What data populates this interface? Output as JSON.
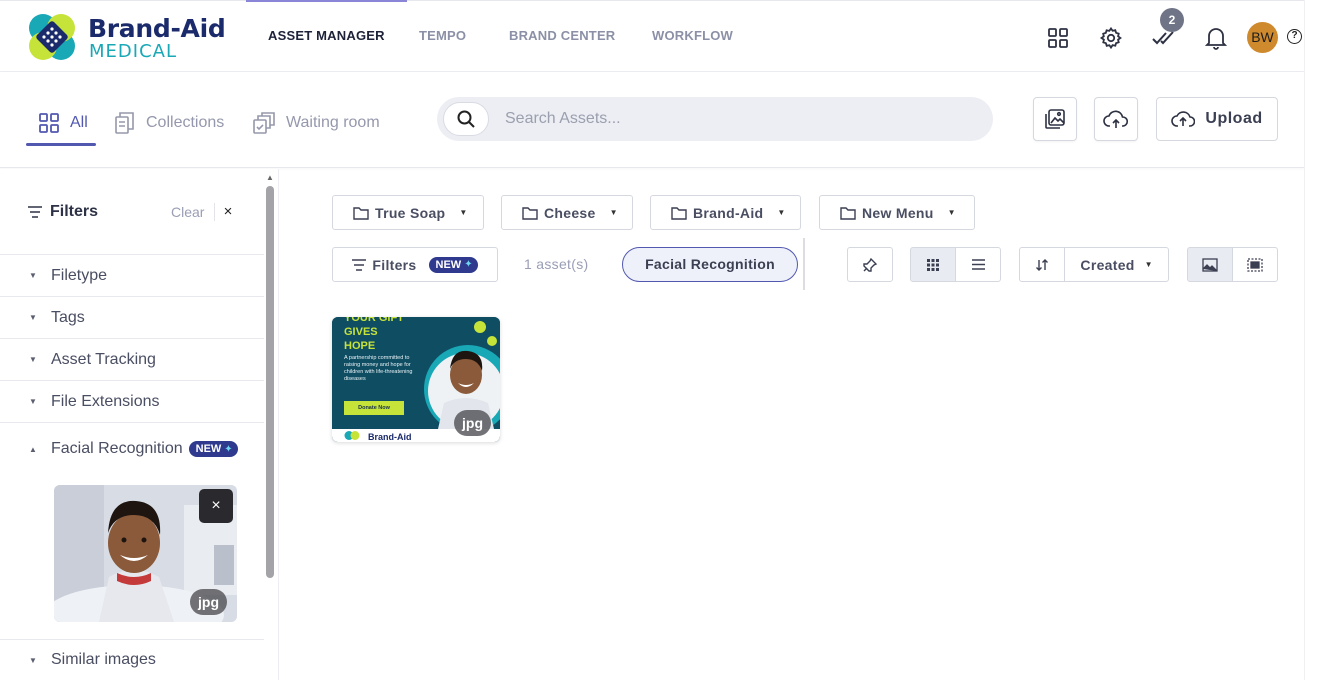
{
  "logo": {
    "line1": "Brand-Aid",
    "line2": "MEDICAL",
    "colors": {
      "navy": "#1b2a6b",
      "teal": "#19a8b6",
      "lime": "#c6e33a"
    }
  },
  "nav": {
    "tabs": [
      {
        "label": "ASSET MANAGER",
        "active": true
      },
      {
        "label": "TEMPO",
        "active": false
      },
      {
        "label": "BRAND CENTER",
        "active": false
      },
      {
        "label": "WORKFLOW",
        "active": false
      }
    ],
    "icons": [
      "apps-grid-icon",
      "settings-gear-icon",
      "tasks-check-icon",
      "notification-bell-icon"
    ],
    "tasks_badge": "2",
    "avatar_initials": "BW",
    "help": "?"
  },
  "subbar": {
    "views": [
      {
        "label": "All",
        "icon": "grid-icon",
        "active": true
      },
      {
        "label": "Collections",
        "icon": "collections-icon",
        "active": false
      },
      {
        "label": "Waiting room",
        "icon": "waiting-room-icon",
        "active": false
      }
    ],
    "search_placeholder": "Search Assets...",
    "upload_label": "Upload"
  },
  "sidebar": {
    "title": "Filters",
    "clear_label": "Clear",
    "close_glyph": "×",
    "items": [
      {
        "label": "Filetype",
        "expanded": false
      },
      {
        "label": "Tags",
        "expanded": false
      },
      {
        "label": "Asset Tracking",
        "expanded": false
      },
      {
        "label": "File Extensions",
        "expanded": false
      },
      {
        "label": "Facial Recognition",
        "expanded": true,
        "badge": "NEW"
      },
      {
        "label": "Similar images",
        "expanded": false
      }
    ],
    "face_filter": {
      "type": "jpg",
      "remove_glyph": "×"
    }
  },
  "toolbar": {
    "folders": [
      "True Soap",
      "Cheese",
      "Brand-Aid",
      "New Menu"
    ],
    "filters_label": "Filters",
    "filters_badge": "NEW",
    "asset_count": "1 asset(s)",
    "active_filter": "Facial Recognition",
    "sort_label": "Created"
  },
  "asset": {
    "headline": [
      "YOUR GIFT",
      "GIVES",
      "HOPE"
    ],
    "body": "A partnership committed to raising money and hope for children with life-threatening diseases",
    "cta": "Donate Now",
    "footer": "Brand-Aid",
    "type": "jpg"
  }
}
